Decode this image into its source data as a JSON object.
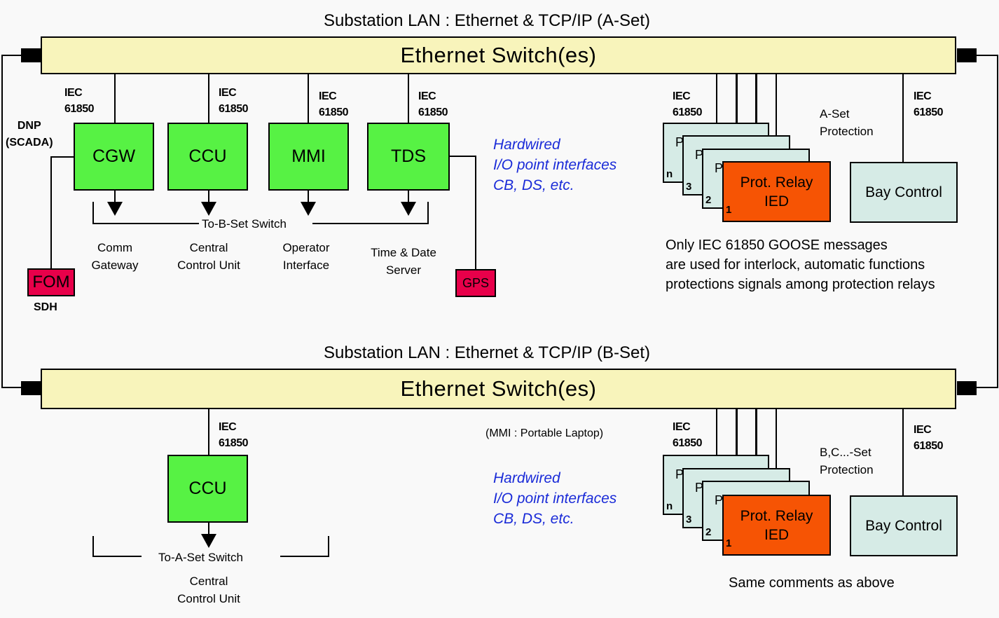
{
  "a_set": {
    "lan_title": "Substation LAN : Ethernet & TCP/IP (A-Set)",
    "switch_label": "Ethernet Switch(es)",
    "protocol_label": [
      "IEC",
      "61850"
    ],
    "dnp_label": [
      "DNP",
      "(SCADA)"
    ],
    "devices": [
      {
        "abbr": "CGW",
        "desc": [
          "Comm",
          "Gateway"
        ]
      },
      {
        "abbr": "CCU",
        "desc": [
          "Central",
          "Control Unit"
        ]
      },
      {
        "abbr": "MMI",
        "desc": [
          "Operator",
          "Interface"
        ]
      },
      {
        "abbr": "TDS",
        "desc": [
          "Time & Date",
          "Server"
        ]
      }
    ],
    "bracket_label": "To-B-Set Switch",
    "fom": {
      "label": "FOM",
      "sublabel": "SDH"
    },
    "gps": {
      "label": "GPS"
    },
    "hardwired": [
      "Hardwired",
      "I/O point interfaces",
      "CB, DS, etc."
    ],
    "protection_label": [
      "A-Set",
      "Protection"
    ],
    "relay_stack": {
      "numbers": [
        "n",
        "3",
        "2",
        "1"
      ],
      "card_letter": "P",
      "front_label": [
        "Prot. Relay",
        "IED"
      ]
    },
    "bay_control": "Bay Control",
    "note": [
      "Only IEC 61850 GOOSE messages",
      "are used for interlock, automatic functions",
      "protections signals among protection relays"
    ]
  },
  "b_set": {
    "lan_title": "Substation LAN : Ethernet & TCP/IP (B-Set)",
    "switch_label": "Ethernet Switch(es)",
    "protocol_label": [
      "IEC",
      "61850"
    ],
    "devices": [
      {
        "abbr": "CCU",
        "desc": [
          "Central",
          "Control Unit"
        ]
      }
    ],
    "bracket_label": "To-A-Set Switch",
    "mmi_note": "(MMI : Portable Laptop)",
    "hardwired": [
      "Hardwired",
      "I/O point interfaces",
      "CB, DS, etc."
    ],
    "protection_label": [
      "B,C...-Set",
      "Protection"
    ],
    "relay_stack": {
      "numbers": [
        "n",
        "3",
        "2",
        "1"
      ],
      "card_letter": "P",
      "front_label": [
        "Prot. Relay",
        "IED"
      ]
    },
    "bay_control": "Bay Control",
    "note": [
      "Same comments as above"
    ]
  },
  "colors": {
    "bus_fill": "#f8f4bb",
    "device_green": "#57f244",
    "alert_red": "#e8004a",
    "relay_orange": "#f65404",
    "card_teal": "#d6ebe6",
    "hardwired_blue": "#1a2bd8"
  }
}
